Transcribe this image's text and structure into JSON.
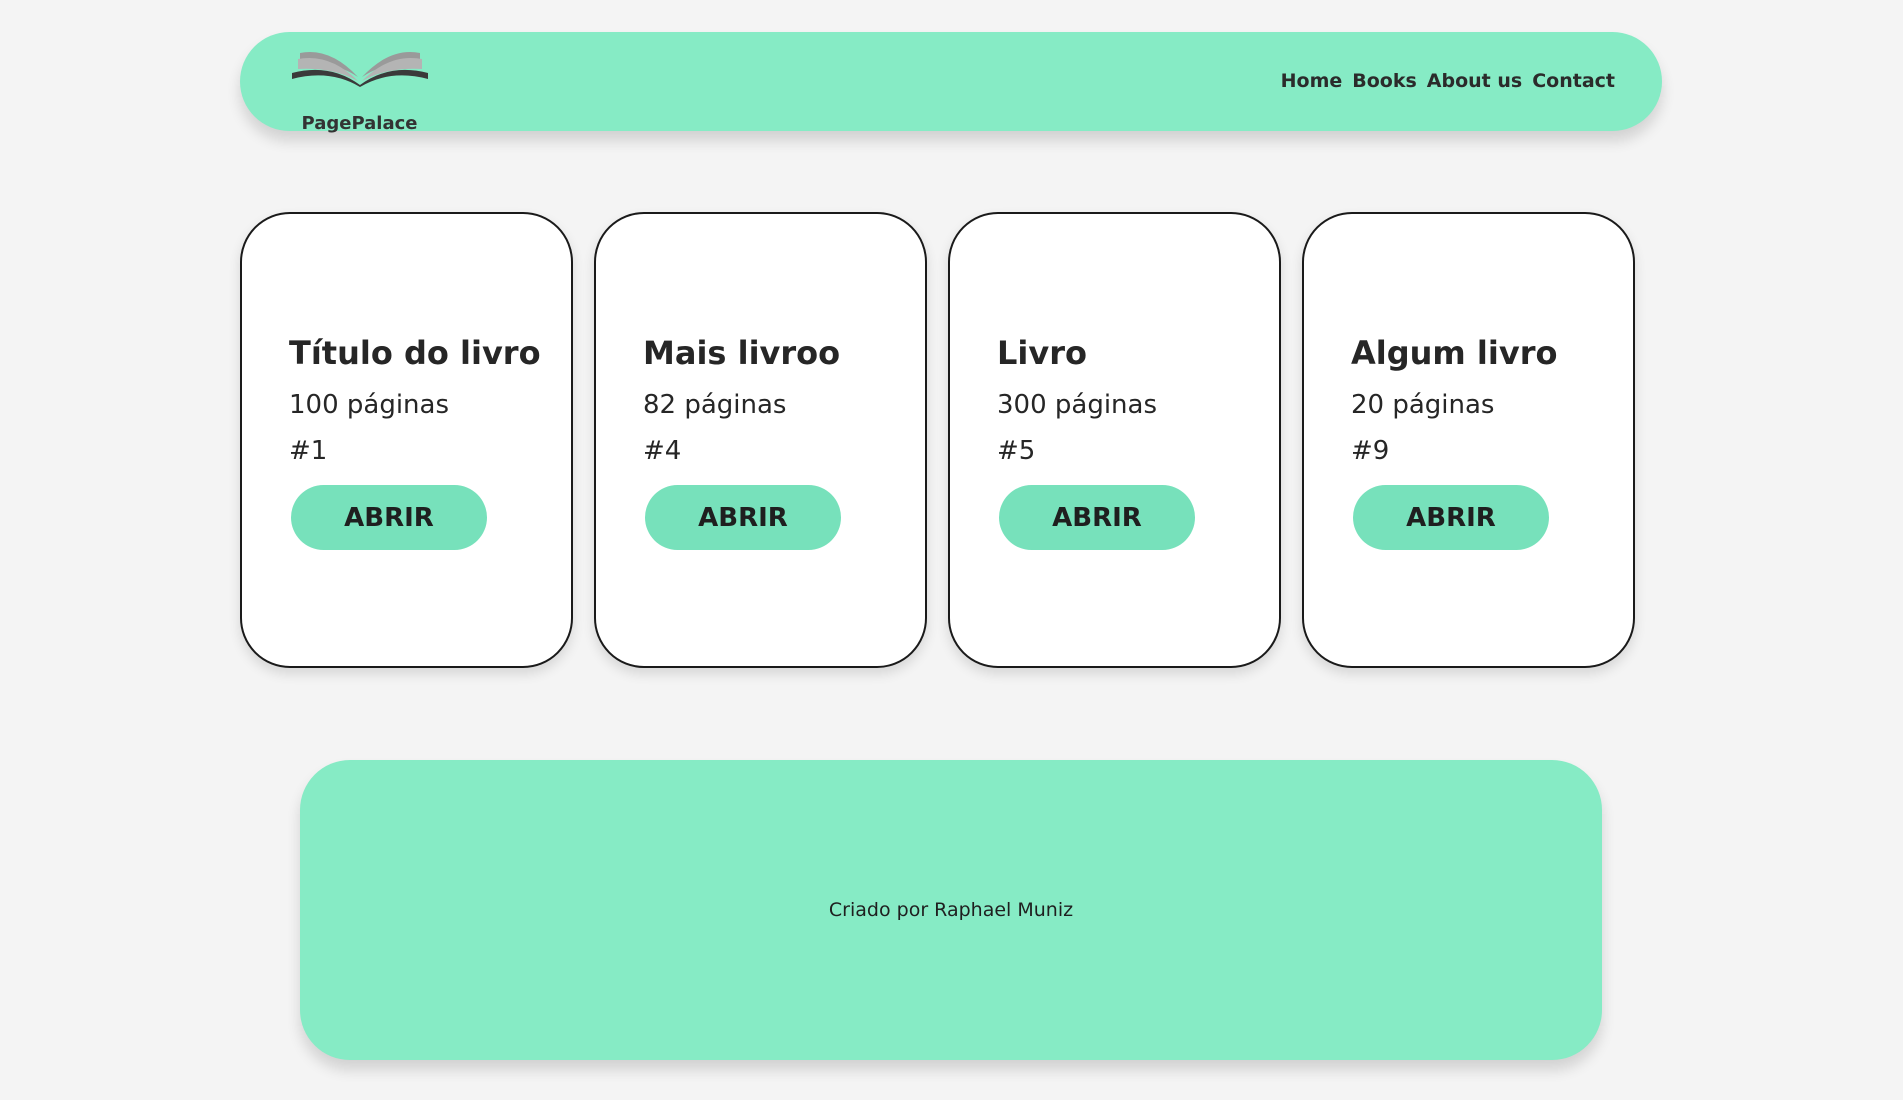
{
  "header": {
    "logo_icon": "open-book-icon",
    "brand": "PagePalace",
    "nav": [
      {
        "label": "Home"
      },
      {
        "label": "Books"
      },
      {
        "label": "About us"
      },
      {
        "label": "Contact"
      }
    ]
  },
  "books": [
    {
      "title": "Título do livro",
      "pages": "100 páginas",
      "rank": "#1",
      "button": "ABRIR"
    },
    {
      "title": "Mais livroo",
      "pages": "82 páginas",
      "rank": "#4",
      "button": "ABRIR"
    },
    {
      "title": "Livro",
      "pages": "300 páginas",
      "rank": "#5",
      "button": "ABRIR"
    },
    {
      "title": "Algum livro",
      "pages": "20 páginas",
      "rank": "#9",
      "button": "ABRIR"
    }
  ],
  "footer": {
    "text": "Criado por Raphael Muniz"
  },
  "colors": {
    "accent": "#86ebc5",
    "button": "#77e1bb",
    "background": "#f4f4f4"
  }
}
